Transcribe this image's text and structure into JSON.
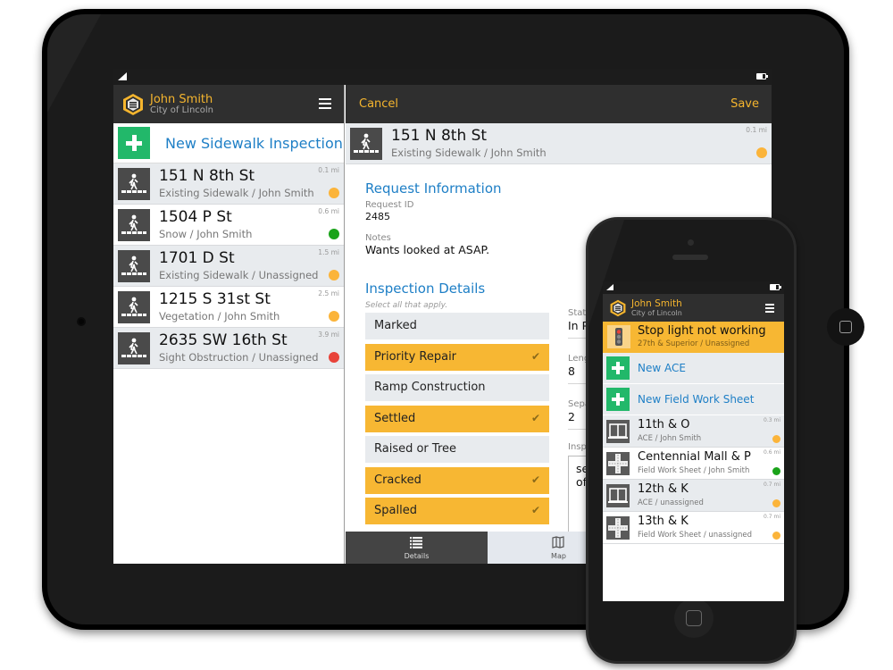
{
  "colors": {
    "accent": "#f5b52e",
    "link_blue": "#1e7fc6",
    "add_green": "#22b86a",
    "status_yellow": "#fbb43a",
    "status_green": "#1aa31a",
    "status_red": "#e8433a",
    "selected_option": "#f7b733",
    "unselected_option": "#e8ebee"
  },
  "tablet": {
    "user": {
      "name": "John Smith",
      "org": "City of Lincoln"
    },
    "new_inspection_label": "New Sidewalk Inspection",
    "list": [
      {
        "title": "151 N 8th St",
        "subtitle": "Existing Sidewalk / John Smith",
        "distance": "0.1 mi",
        "status": "yellow",
        "icon": "pedestrian-crosswalk-icon"
      },
      {
        "title": "1504 P St",
        "subtitle": "Snow / John Smith",
        "distance": "0.6 mi",
        "status": "green",
        "icon": "pedestrian-crosswalk-icon"
      },
      {
        "title": "1701 D St",
        "subtitle": "Existing Sidewalk / Unassigned",
        "distance": "1.5 mi",
        "status": "yellow",
        "icon": "pedestrian-crosswalk-icon"
      },
      {
        "title": "1215 S 31st St",
        "subtitle": "Vegetation / John Smith",
        "distance": "2.5 mi",
        "status": "yellow",
        "icon": "pedestrian-crosswalk-icon"
      },
      {
        "title": "2635 SW 16th St",
        "subtitle": "Sight Obstruction / Unassigned",
        "distance": "3.9 mi",
        "status": "red",
        "icon": "pedestrian-crosswalk-icon"
      }
    ],
    "detail": {
      "cancel_label": "Cancel",
      "save_label": "Save",
      "record": {
        "title": "151 N 8th St",
        "subtitle": "Existing Sidewalk / John Smith",
        "distance": "0.1 mi",
        "status": "yellow"
      },
      "request_info_title": "Request Information",
      "request_id_label": "Request ID",
      "request_id_value": "2485",
      "notes_label": "Notes",
      "notes_value": "Wants looked at ASAP.",
      "inspection_title": "Inspection Details",
      "inspection_hint": "Select all that apply.",
      "options": [
        {
          "label": "Marked",
          "selected": false
        },
        {
          "label": "Priority Repair",
          "selected": true
        },
        {
          "label": "Ramp Construction",
          "selected": false
        },
        {
          "label": "Settled",
          "selected": true
        },
        {
          "label": "Raised or Tree",
          "selected": false
        },
        {
          "label": "Cracked",
          "selected": true
        },
        {
          "label": "Spalled",
          "selected": true
        }
      ],
      "check_glyph": "✔",
      "side_fields": [
        {
          "label": "Stat",
          "value": "In P"
        },
        {
          "label": "Leng",
          "value": "8"
        },
        {
          "label": "Sepa",
          "value": "2"
        }
      ],
      "inspection_notes_label": "Insp",
      "inspection_notes_value_lines": [
        "se",
        "of"
      ],
      "tabs": [
        {
          "label": "Details",
          "icon": "list-icon",
          "active": true
        },
        {
          "label": "Map",
          "icon": "map-icon",
          "active": false
        }
      ]
    }
  },
  "phone": {
    "user": {
      "name": "John Smith",
      "org": "City of Lincoln"
    },
    "alert": {
      "title": "Stop light not working",
      "subtitle": "27th & Superior / Unassigned",
      "icon": "traffic-light-icon"
    },
    "new_buttons": [
      {
        "label": "New ACE"
      },
      {
        "label": "New Field Work Sheet"
      }
    ],
    "list": [
      {
        "title": "11th & O",
        "subtitle": "ACE / John Smith",
        "distance": "0.3 mi",
        "status": "yellow",
        "icon": "ace-frame-icon"
      },
      {
        "title": "Centennial Mall & P",
        "subtitle": "Field Work Sheet / John Smith",
        "distance": "0.6 mi",
        "status": "green",
        "icon": "intersection-icon"
      },
      {
        "title": "12th & K",
        "subtitle": "ACE / unassigned",
        "distance": "0.7 mi",
        "status": "yellow",
        "icon": "ace-frame-icon"
      },
      {
        "title": "13th & K",
        "subtitle": "Field Work Sheet / unassigned",
        "distance": "0.7 mi",
        "status": "yellow",
        "icon": "intersection-icon"
      }
    ]
  }
}
